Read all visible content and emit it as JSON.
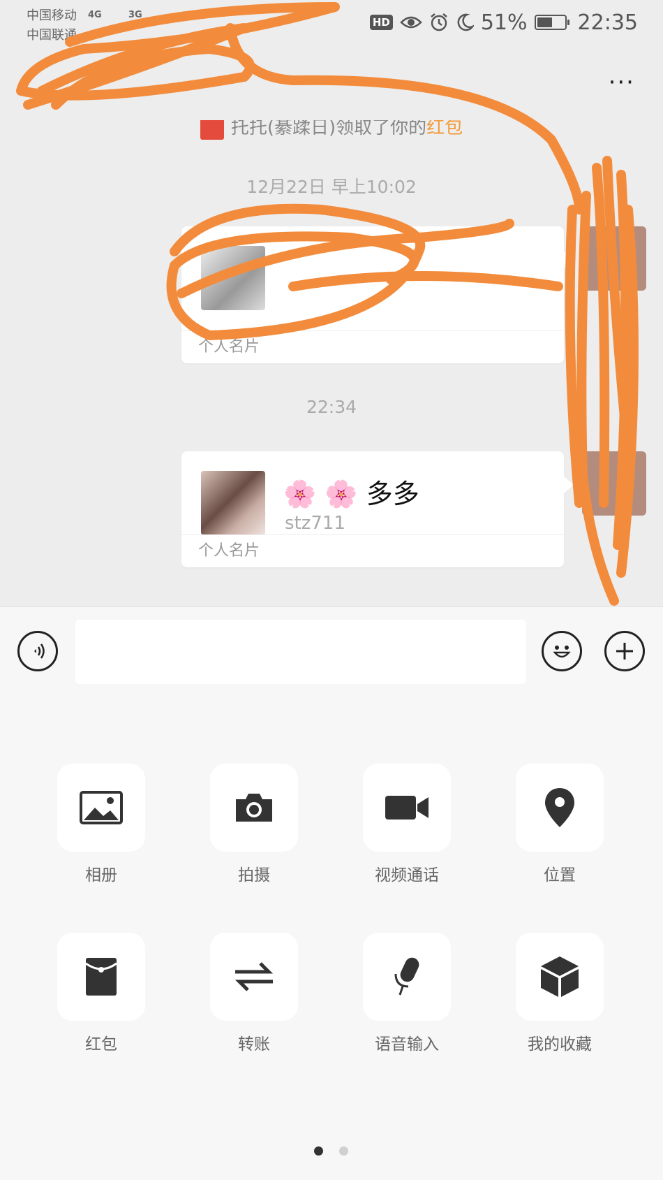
{
  "status_bar": {
    "carrier_1": "中国移动",
    "carrier_2": "中国联通",
    "net_1": "4G",
    "net_2": "3G",
    "hd": "HD",
    "battery": "51%",
    "time": "22:35"
  },
  "header": {
    "back_icon": "chevron-left",
    "more_label": "···"
  },
  "chat": {
    "notice_text": "托托(綦蹂日)领取了你的",
    "notice_link": "红包",
    "timestamps": [
      "12月22日 早上10:02",
      "22:34"
    ],
    "cards": [
      {
        "name": "",
        "id": "",
        "footer": "个人名片"
      },
      {
        "name": "🌸 🌸 多多",
        "id": "stz711",
        "footer": "个人名片"
      }
    ]
  },
  "input_bar": {
    "voice_icon": "voice-icon",
    "emoji_icon": "emoji-icon",
    "plus_icon": "plus-icon"
  },
  "panel": {
    "items": [
      {
        "label": "相册",
        "icon": "photo-album-icon"
      },
      {
        "label": "拍摄",
        "icon": "camera-icon"
      },
      {
        "label": "视频通话",
        "icon": "video-call-icon"
      },
      {
        "label": "位置",
        "icon": "location-icon"
      },
      {
        "label": "红包",
        "icon": "red-packet-icon"
      },
      {
        "label": "转账",
        "icon": "transfer-icon"
      },
      {
        "label": "语音输入",
        "icon": "microphone-icon"
      },
      {
        "label": "我的收藏",
        "icon": "favorites-icon"
      }
    ],
    "page_count": 2,
    "active_page": 1
  },
  "colors": {
    "scribble": "#f28c3c",
    "accent_link": "#f39b3b"
  }
}
